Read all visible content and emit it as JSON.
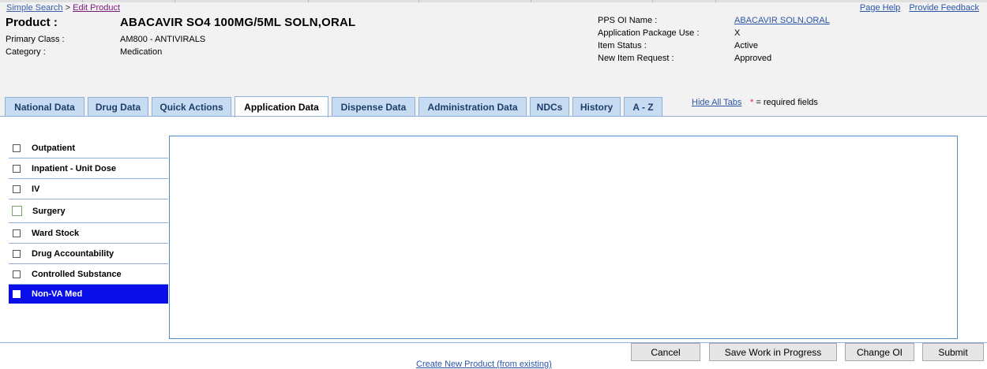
{
  "breadcrumb": {
    "root": "Simple Search",
    "separator": ">",
    "current": "Edit Product"
  },
  "toplinks": {
    "page_help": "Page Help",
    "feedback": "Provide Feedback"
  },
  "product": {
    "label": "Product :",
    "name": "ABACAVIR SO4 100MG/5ML SOLN,ORAL",
    "primary_class_label": "Primary Class :",
    "primary_class_value": "AM800 - ANTIVIRALS",
    "category_label": "Category :",
    "category_value": "Medication"
  },
  "details": {
    "pps_label": "PPS OI Name :",
    "pps_value": "ABACAVIR SOLN,ORAL",
    "app_pkg_label": "Application Package Use :",
    "app_pkg_value": "X",
    "status_label": "Item Status :",
    "status_value": "Active",
    "new_item_label": "New Item Request :",
    "new_item_value": "Approved"
  },
  "tabs": [
    {
      "label": "National Data"
    },
    {
      "label": "Drug Data"
    },
    {
      "label": "Quick Actions"
    },
    {
      "label": "Application Data"
    },
    {
      "label": "Dispense Data"
    },
    {
      "label": "Administration Data"
    },
    {
      "label": "NDCs"
    },
    {
      "label": "History"
    },
    {
      "label": "A - Z"
    }
  ],
  "active_tab": "Application Data",
  "hide_tabs": "Hide All Tabs",
  "required_note": {
    "star": "*",
    "text": " = required fields"
  },
  "sidebar": {
    "items": [
      {
        "label": "Outpatient",
        "checked": false
      },
      {
        "label": "Inpatient - Unit Dose",
        "checked": false
      },
      {
        "label": "IV",
        "checked": false
      },
      {
        "label": "Surgery",
        "checked": false
      },
      {
        "label": "Ward Stock",
        "checked": false
      },
      {
        "label": "Drug Accountability",
        "checked": false
      },
      {
        "label": "Controlled Substance",
        "checked": false
      },
      {
        "label": "Non-VA Med",
        "checked": false
      }
    ],
    "selected": "Non-VA Med",
    "selected_color": "#0a0ee8"
  },
  "buttons": {
    "cancel": "Cancel",
    "save": "Save Work in Progress",
    "change_oi": "Change OI",
    "submit": "Submit"
  },
  "create_link": "Create New Product (from existing)"
}
